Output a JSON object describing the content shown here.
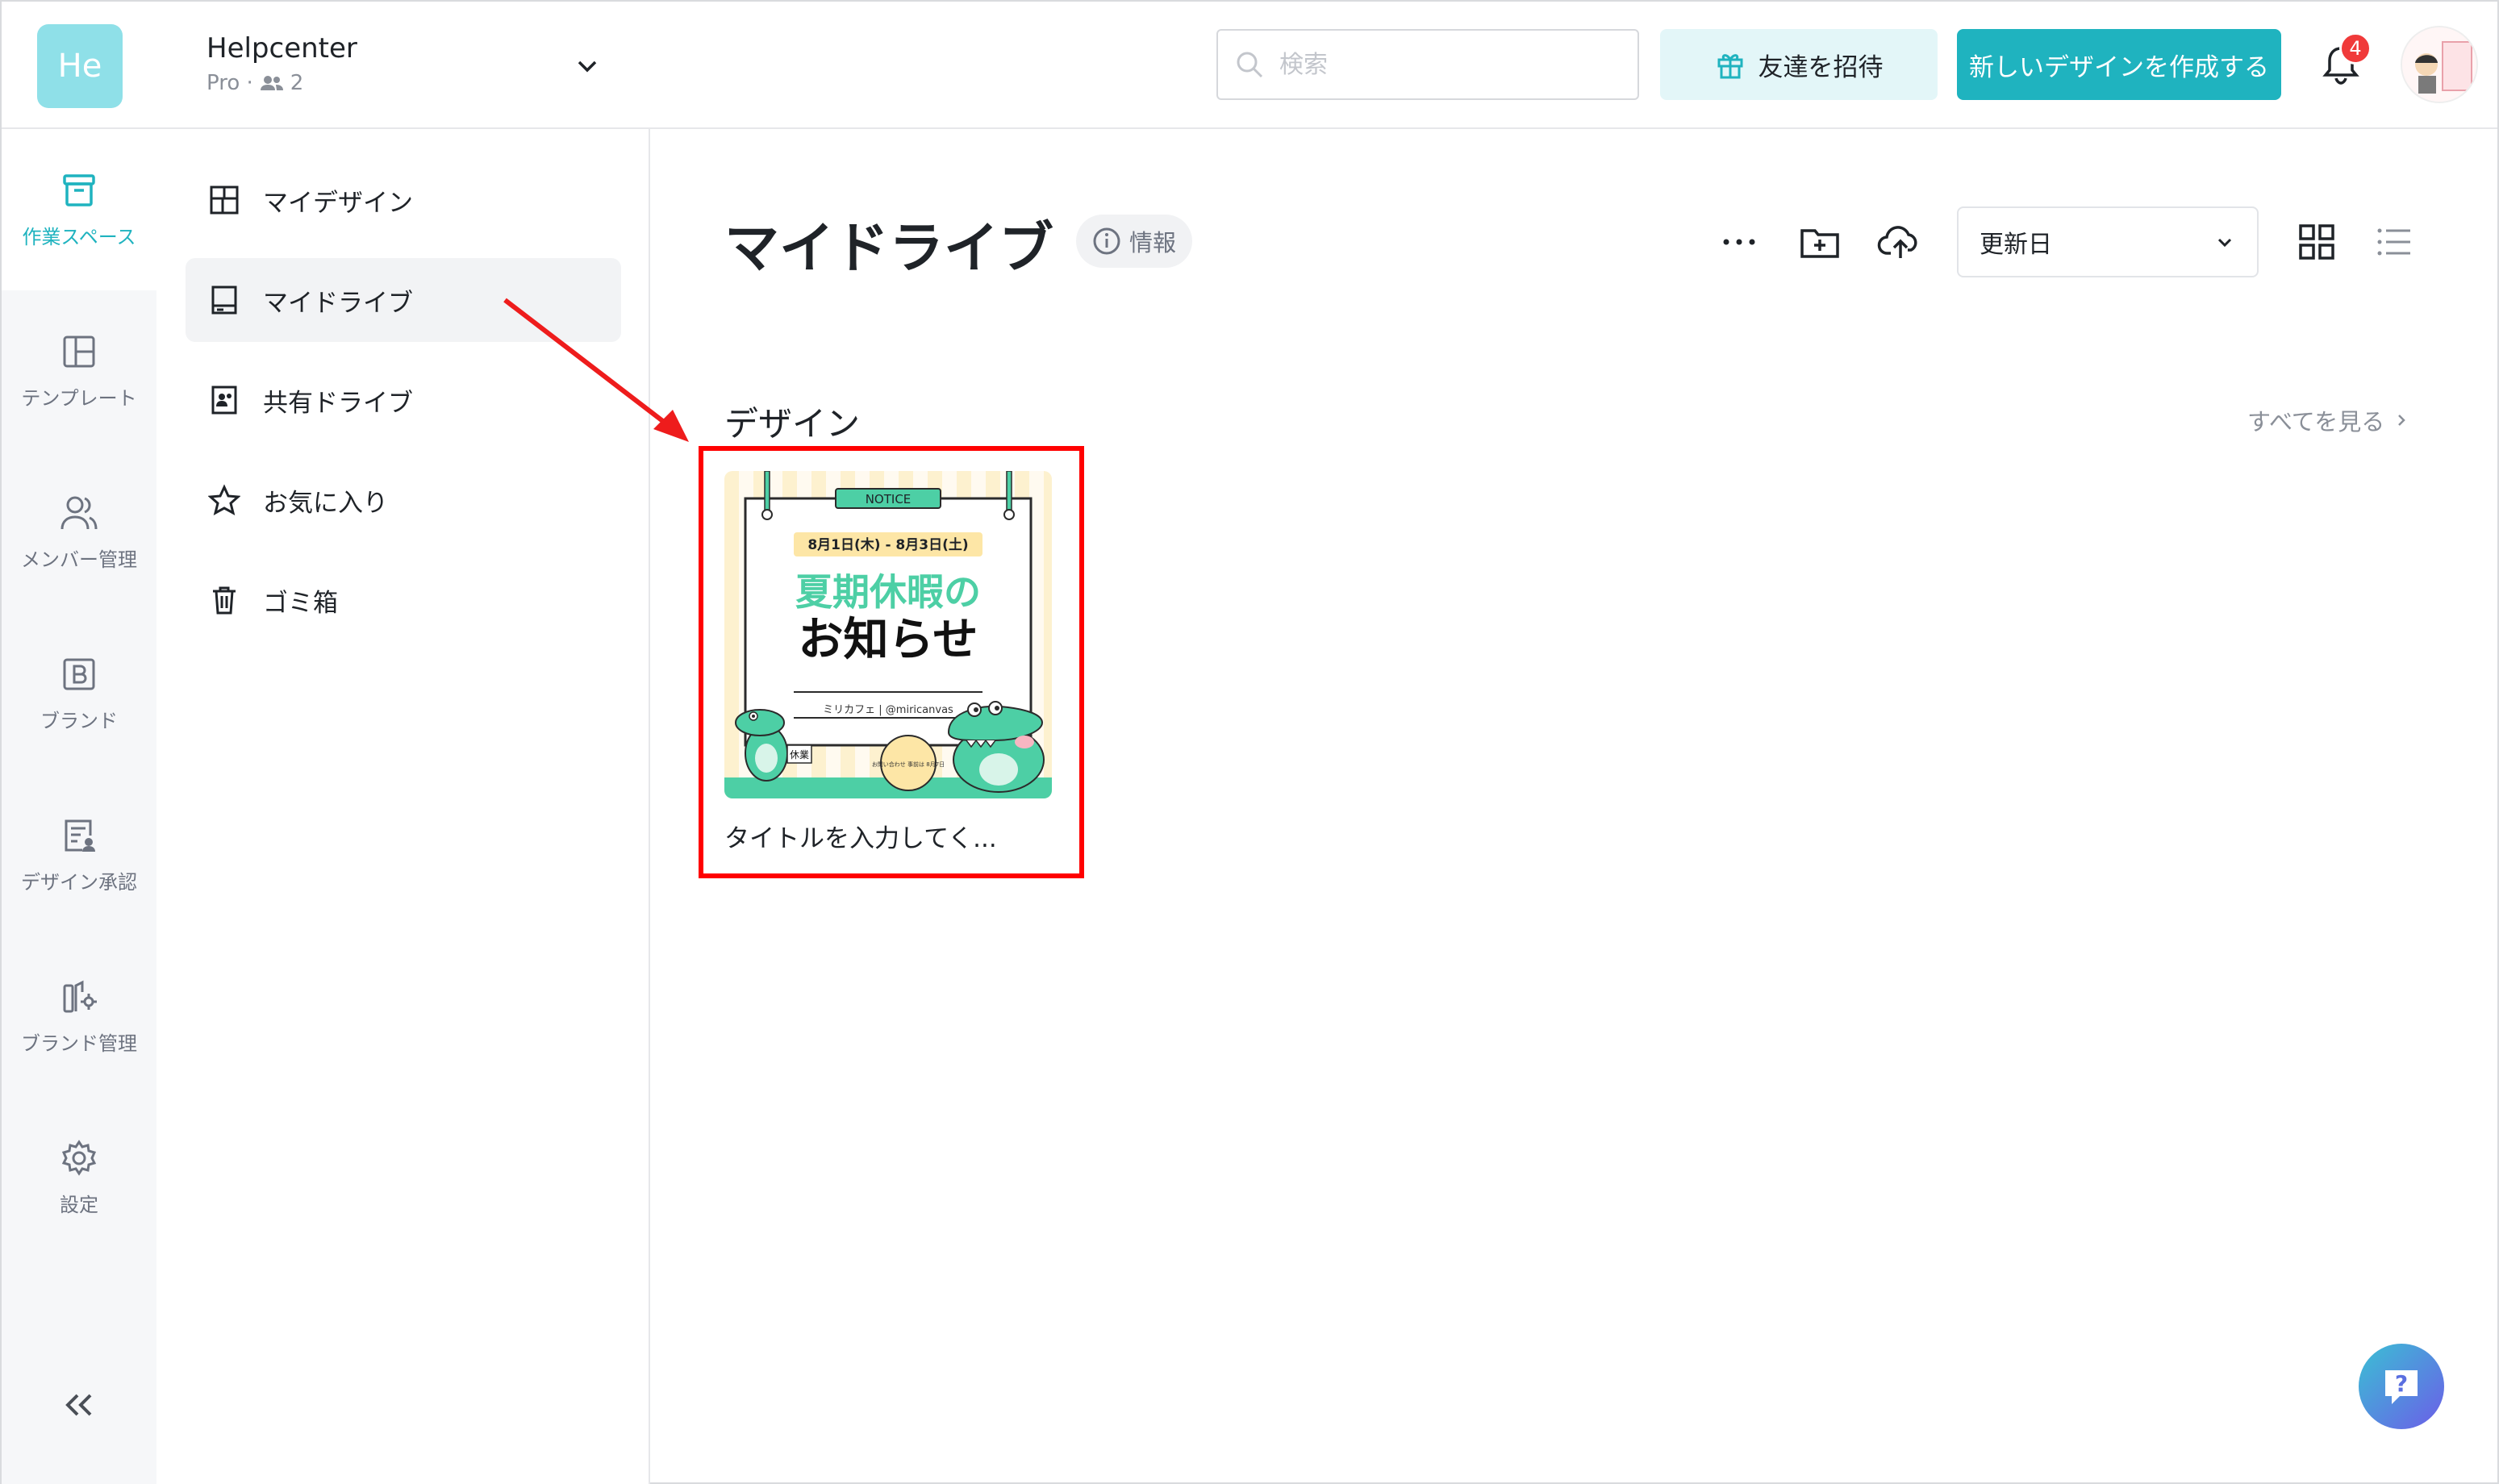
{
  "header": {
    "workspace_initials": "He",
    "workspace_name": "Helpcenter",
    "plan": "Pro ·",
    "member_count": "2",
    "search_placeholder": "検索",
    "invite_label": "友達を招待",
    "create_label": "新しいデザインを作成する",
    "notification_count": "4"
  },
  "rail": {
    "items": [
      {
        "label": "作業スペース",
        "icon": "archive-box-icon"
      },
      {
        "label": "テンプレート",
        "icon": "template-layout-icon"
      },
      {
        "label": "メンバー管理",
        "icon": "users-icon"
      },
      {
        "label": "ブランド",
        "icon": "brand-b-icon"
      },
      {
        "label": "デザイン承認",
        "icon": "approval-document-icon"
      },
      {
        "label": "ブランド管理",
        "icon": "brand-settings-icon"
      },
      {
        "label": "設定",
        "icon": "gear-icon"
      }
    ]
  },
  "subnav": {
    "items": [
      {
        "label": "マイデザイン",
        "icon": "grid-layout-icon"
      },
      {
        "label": "マイドライブ",
        "icon": "drive-icon"
      },
      {
        "label": "共有ドライブ",
        "icon": "shared-drive-icon"
      },
      {
        "label": "お気に入り",
        "icon": "star-icon"
      },
      {
        "label": "ゴミ箱",
        "icon": "trash-icon"
      }
    ]
  },
  "main": {
    "title": "マイドライブ",
    "info_label": "情報",
    "sort_value": "更新日",
    "section_title": "デザイン",
    "see_all": "すべてを見る"
  },
  "design_card": {
    "title": "タイトルを入力してく...",
    "thumbnail": {
      "notice": "NOTICE",
      "dates": "8月1日(木) - 8月3日(土)",
      "headline_1": "夏期休暇の",
      "headline_2": "お知らせ",
      "brand": "ミリカフェ | @miricanvas",
      "sign": "休業",
      "bubble": "お問い合わせ 事前は 8月7日",
      "accent_green": "#4dcfa5",
      "accent_yellow": "#fde6a6"
    }
  },
  "colors": {
    "brand": "#1fb3bf",
    "highlight": "#ff0000",
    "badge": "#f03a3a"
  }
}
